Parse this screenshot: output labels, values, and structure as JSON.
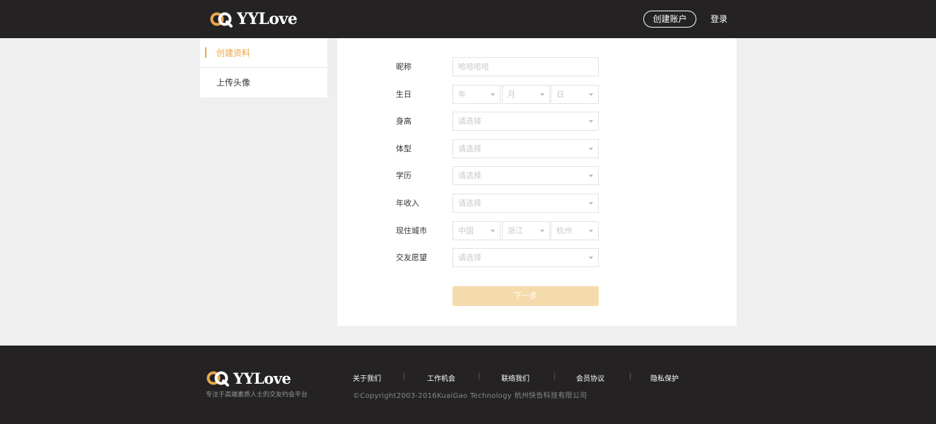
{
  "header": {
    "logo_text": "YYLove",
    "create_account": "创建账户",
    "login": "登录"
  },
  "sidebar": {
    "items": [
      {
        "label": "创建资料",
        "active": true
      },
      {
        "label": "上传头像",
        "active": false
      }
    ]
  },
  "form": {
    "nickname": {
      "label": "昵称",
      "placeholder": "哈哈哈哈"
    },
    "birthday": {
      "label": "生日",
      "year": "年",
      "month": "月",
      "day": "日"
    },
    "height": {
      "label": "身高",
      "value": "请选择"
    },
    "body_type": {
      "label": "体型",
      "value": "请选择"
    },
    "education": {
      "label": "学历",
      "value": "请选择"
    },
    "income": {
      "label": "年收入",
      "value": "请选择"
    },
    "city": {
      "label": "现住城市",
      "country": "中国",
      "province": "浙江",
      "city": "杭州"
    },
    "wish": {
      "label": "交友愿望",
      "value": "请选择"
    },
    "next_button": "下一步"
  },
  "footer": {
    "logo_text": "YYLove",
    "tagline": "专注于高端素质人士的交友约会平台",
    "links": [
      "关于我们",
      "工作机会",
      "联络我们",
      "会员协议",
      "隐私保护"
    ],
    "separator": "|",
    "copyright": "©Copyright2003-2016KuaiGao Technology 杭州快告科技有限公司"
  },
  "colors": {
    "accent": "#e8a64b",
    "header_bg": "#242223",
    "button_disabled": "#f5dbac"
  }
}
